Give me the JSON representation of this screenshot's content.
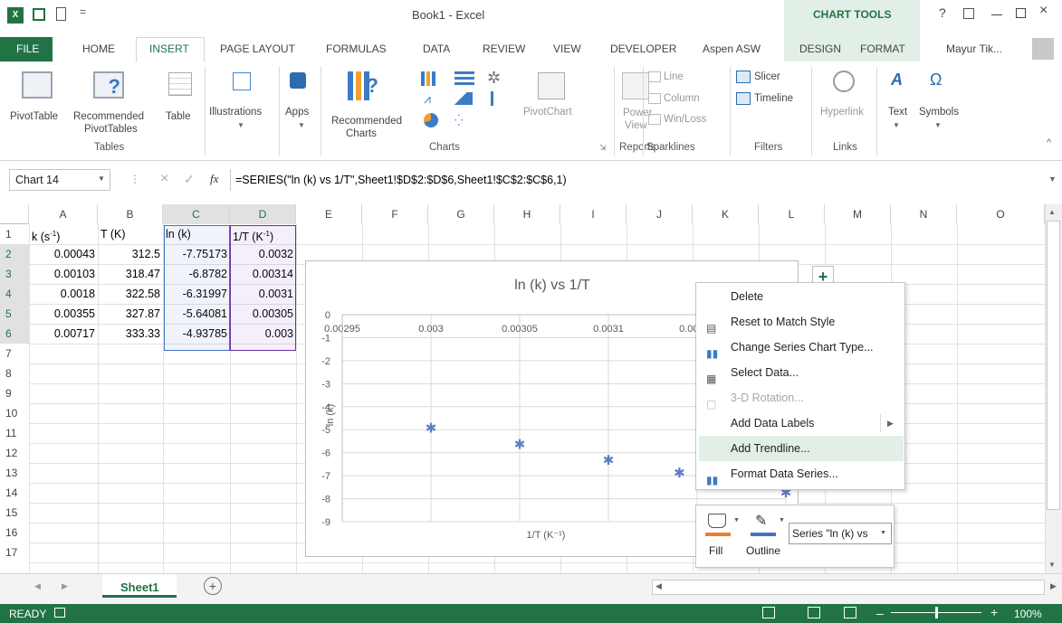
{
  "window": {
    "title": "Book1 - Excel",
    "context_tab": "CHART TOOLS",
    "user": "Mayur Tik...",
    "help": "?"
  },
  "tabs": [
    "FILE",
    "HOME",
    "INSERT",
    "PAGE LAYOUT",
    "FORMULAS",
    "DATA",
    "REVIEW",
    "VIEW",
    "DEVELOPER",
    "Aspen ASW",
    "DESIGN",
    "FORMAT"
  ],
  "ribbon": {
    "pivot_table": "PivotTable",
    "rec_pivot": "Recommended",
    "rec_pivot2": "PivotTables",
    "table": "Table",
    "illustrations": "Illustrations",
    "apps": "Apps",
    "rec_charts": "Recommended",
    "rec_charts2": "Charts",
    "pivot_chart": "PivotChart",
    "power_view": "Power",
    "power_view2": "View",
    "spark_line": "Line",
    "spark_column": "Column",
    "spark_winloss": "Win/Loss",
    "slicer": "Slicer",
    "timeline": "Timeline",
    "hyperlink": "Hyperlink",
    "text": "Text",
    "symbols": "Symbols",
    "groups": {
      "tables": "Tables",
      "charts": "Charts",
      "reports": "Reports",
      "sparklines": "Sparklines",
      "filters": "Filters",
      "links": "Links"
    }
  },
  "formula_bar": {
    "name_box": "Chart 14",
    "fx": "fx",
    "formula": "=SERIES(\"ln (k) vs 1/T\",Sheet1!$D$2:$D$6,Sheet1!$C$2:$C$6,1)"
  },
  "columns": [
    "A",
    "B",
    "C",
    "D",
    "E",
    "F",
    "G",
    "H",
    "I",
    "J",
    "K",
    "L",
    "M",
    "N",
    "O"
  ],
  "rows": [
    "1",
    "2",
    "3",
    "4",
    "5",
    "6",
    "7",
    "8",
    "9",
    "10",
    "11",
    "12",
    "13",
    "14",
    "15",
    "16",
    "17"
  ],
  "headers": {
    "a": "k (s",
    "a_sup": "-1",
    "a_end": ")",
    "b": "T (K)",
    "c": "ln (k)",
    "d": "1/T (K",
    "d_sup": "-1",
    "d_end": ")"
  },
  "data_rows": [
    [
      "0.00043",
      "312.5",
      "-7.75173",
      "0.0032"
    ],
    [
      "0.00103",
      "318.47",
      "-6.8782",
      "0.00314"
    ],
    [
      "0.0018",
      "322.58",
      "-6.31997",
      "0.0031"
    ],
    [
      "0.00355",
      "327.87",
      "-5.64081",
      "0.00305"
    ],
    [
      "0.00717",
      "333.33",
      "-4.93785",
      "0.003"
    ]
  ],
  "chart_data": {
    "type": "scatter",
    "title": "ln (k) vs 1/T",
    "xlabel": "1/T (K⁻¹)",
    "ylabel": "ln (k)",
    "x_ticks": [
      "0.00295",
      "0.003",
      "0.00305",
      "0.0031",
      "0.00315",
      "0.00"
    ],
    "y_ticks": [
      "0",
      "-1",
      "-2",
      "-3",
      "-4",
      "-5",
      "-6",
      "-7",
      "-8",
      "-9"
    ],
    "xlim": [
      0.00295,
      0.0032
    ],
    "ylim": [
      -9,
      0
    ],
    "series": [
      {
        "name": "ln (k) vs 1/T",
        "x": [
          0.0032,
          0.00314,
          0.0031,
          0.00305,
          0.003
        ],
        "y": [
          -7.75173,
          -6.8782,
          -6.31997,
          -5.64081,
          -4.93785
        ]
      }
    ],
    "grid": true
  },
  "context_menu": {
    "items": [
      "Delete",
      "Reset to Match Style",
      "Change Series Chart Type...",
      "Select Data...",
      "3-D Rotation...",
      "Add Data Labels",
      "Add Trendline...",
      "Format Data Series..."
    ],
    "highlighted": "Add Trendline..."
  },
  "mini_toolbar": {
    "fill": "Fill",
    "outline": "Outline",
    "series_select": "Series \"ln (k) vs"
  },
  "sheet_tab": "Sheet1",
  "status": {
    "ready": "READY",
    "zoom": "100%"
  },
  "colors": {
    "excel_green": "#217346",
    "selection_blue": "#4472c4",
    "selection_purple": "#7030a0",
    "marker": "#5b7fc7",
    "highlight": "#e2efe6"
  }
}
